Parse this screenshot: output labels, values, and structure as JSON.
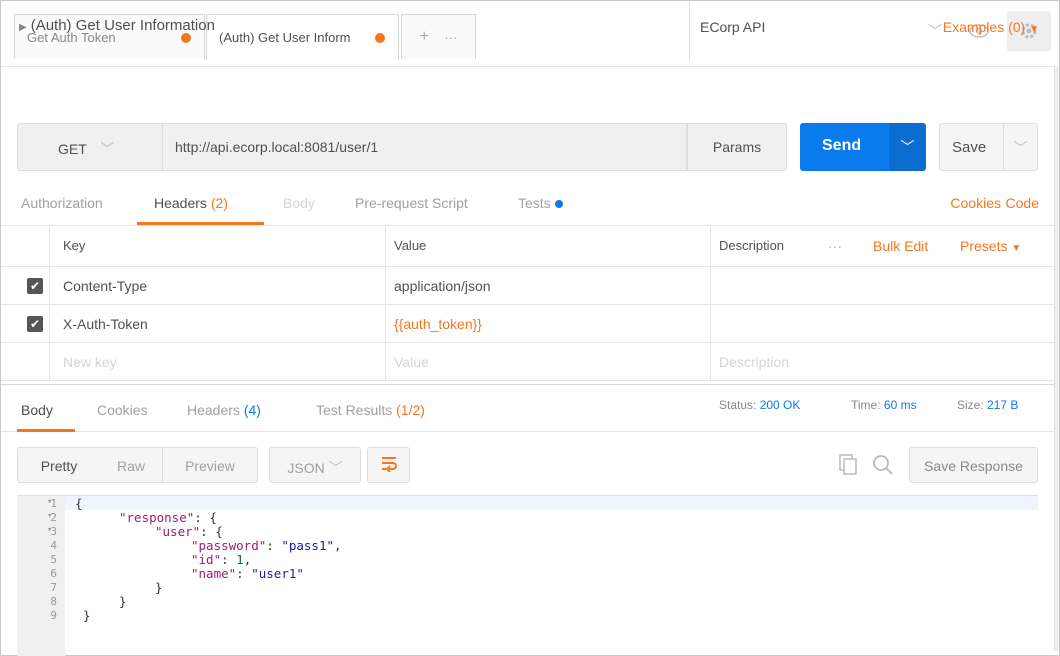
{
  "tabs": [
    {
      "label": "Get Auth Token"
    },
    {
      "label": "(Auth) Get User Inform"
    }
  ],
  "new_tab": {
    "plus": "+",
    "more": "···"
  },
  "environment": {
    "selected": "ECorp API"
  },
  "request": {
    "title": "(Auth) Get User Information",
    "examples": "Examples (0)",
    "method": "GET",
    "url": "http://api.ecorp.local:8081/user/1",
    "params": "Params",
    "send": "Send",
    "save": "Save"
  },
  "request_tabs": {
    "authorization": "Authorization",
    "headers": "Headers",
    "headers_count": "(2)",
    "body": "Body",
    "prerequest": "Pre-request Script",
    "tests": "Tests",
    "cookies": "Cookies",
    "code": "Code"
  },
  "headers_table": {
    "col_key": "Key",
    "col_value": "Value",
    "col_description": "Description",
    "more": "···",
    "bulk_edit": "Bulk Edit",
    "presets": "Presets",
    "rows": [
      {
        "key": "Content-Type",
        "value": "application/json",
        "checked": true
      },
      {
        "key": "X-Auth-Token",
        "value": "{{auth_token}}",
        "checked": true
      }
    ],
    "placeholder": {
      "key": "New key",
      "value": "Value",
      "description": "Description"
    }
  },
  "response_tabs": {
    "body": "Body",
    "cookies": "Cookies",
    "headers": "Headers",
    "headers_count": "(4)",
    "test_results": "Test Results",
    "test_results_count": "(1/2)"
  },
  "status": {
    "status_label": "Status:",
    "status_value": "200 OK",
    "time_label": "Time:",
    "time_value": "60 ms",
    "size_label": "Size:",
    "size_value": "217 B"
  },
  "view": {
    "pretty": "Pretty",
    "raw": "Raw",
    "preview": "Preview",
    "format": "JSON",
    "save_response": "Save Response"
  },
  "code_lines": [
    "1",
    "2",
    "3",
    "4",
    "5",
    "6",
    "7",
    "8",
    "9"
  ],
  "code": {
    "l1": "{",
    "l2_key": "\"response\"",
    "l2_rest": ": {",
    "l3_key": "\"user\"",
    "l3_rest": ": {",
    "l4_key": "\"password\"",
    "l4_val": "\"pass1\"",
    "l5_key": "\"id\"",
    "l5_val": "1",
    "l6_key": "\"name\"",
    "l6_val": "\"user1\"",
    "l7": "}",
    "l8": "}",
    "l9": "}"
  },
  "colors": {
    "accent": "#f4771d",
    "primary": "#097bed"
  }
}
